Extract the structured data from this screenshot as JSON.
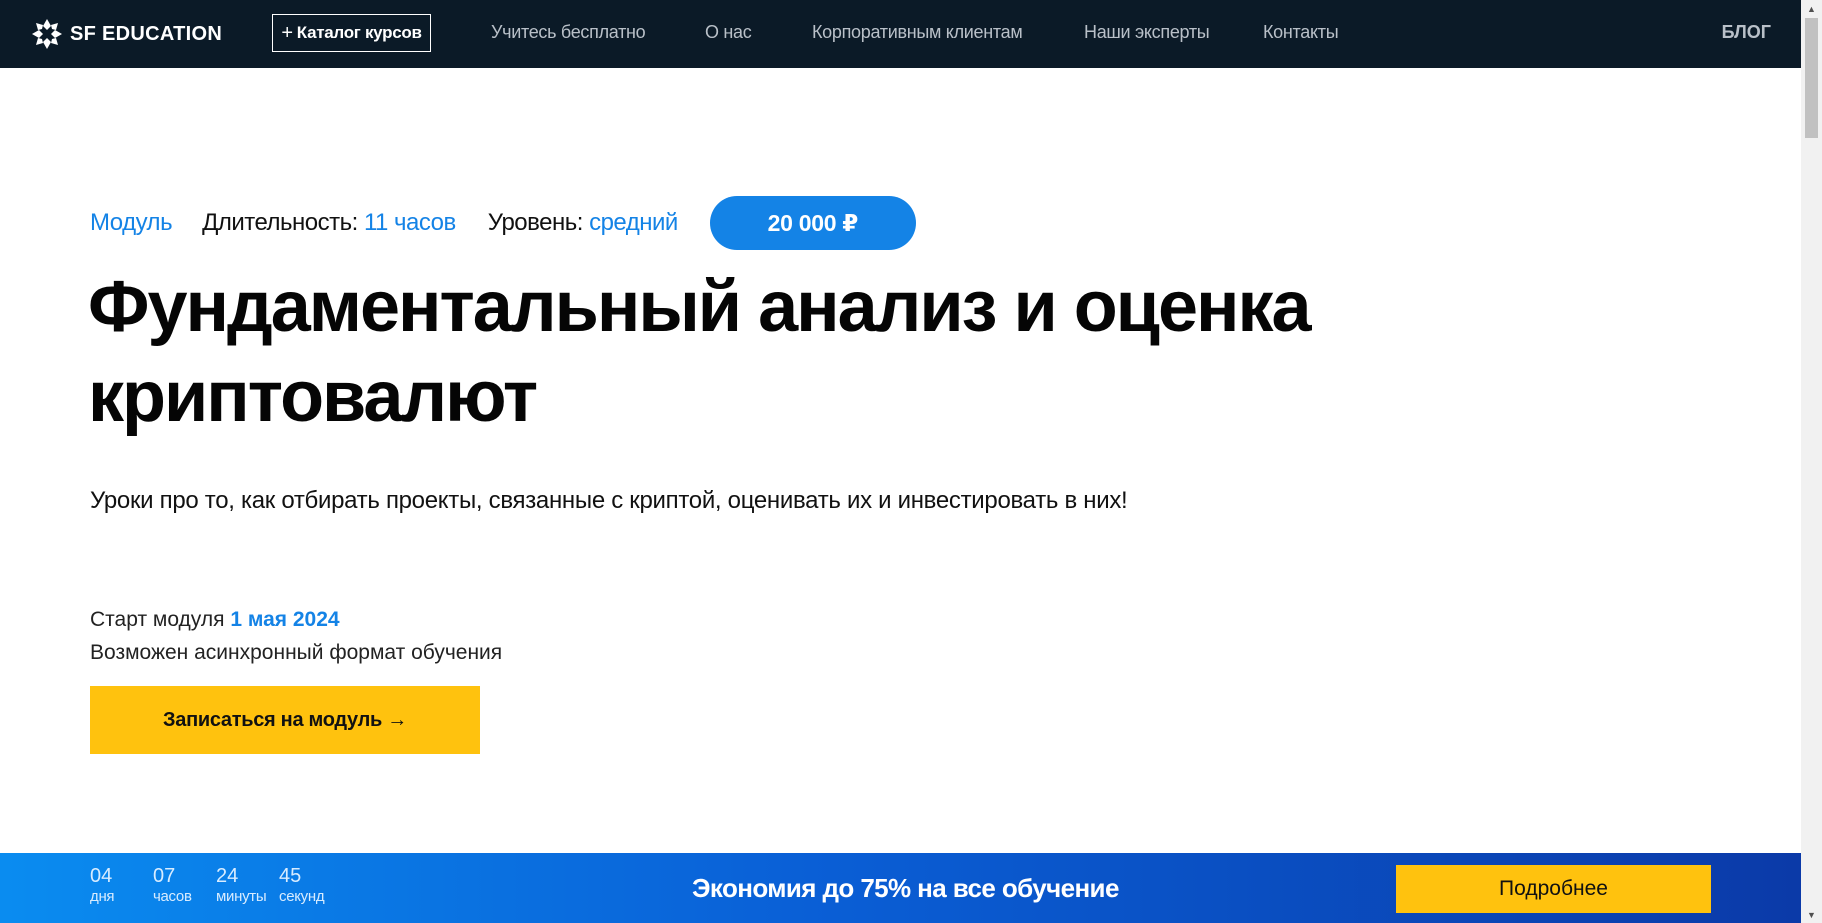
{
  "header": {
    "logo_text": "SF EDUCATION",
    "catalog_label": "Каталог курсов",
    "nav": [
      "Учитесь бесплатно",
      "О нас",
      "Корпоративным клиентам",
      "Наши эксперты",
      "Контакты"
    ],
    "blog": "БЛОГ"
  },
  "meta": {
    "type": "Модуль",
    "duration_label": "Длительность:",
    "duration_value": "11 часов",
    "level_label": "Уровень:",
    "level_value": "средний",
    "price": "20 000 ₽"
  },
  "hero": {
    "title_line1": "Фундаментальный анализ и оценка",
    "title_line2": "криптовалют",
    "subtitle": "Уроки про то, как отбирать проекты, связанные с криптой, оценивать их и инвестировать в них!",
    "start_label": "Старт модуля",
    "start_date": "1 мая 2024",
    "format": "Возможен асинхронный формат обучения",
    "enroll_label": "Записаться на модуль →"
  },
  "promo": {
    "countdown": [
      {
        "num": "04",
        "label": "дня"
      },
      {
        "num": "07",
        "label": "часов"
      },
      {
        "num": "24",
        "label": "минуты"
      },
      {
        "num": "45",
        "label": "секунд"
      }
    ],
    "text": "Экономия до 75% на все обучение",
    "button": "Подробнее"
  },
  "colors": {
    "header_bg": "#0b1a27",
    "accent_blue": "#1483e6",
    "cta_yellow": "#ffc20e"
  }
}
